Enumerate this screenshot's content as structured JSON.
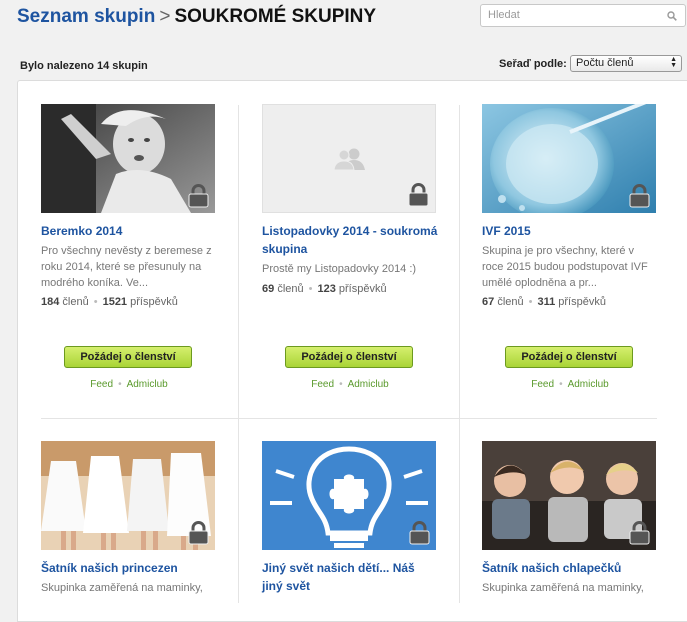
{
  "header": {
    "breadcrumb_link": "Seznam skupin",
    "separator": ">",
    "current": "SOUKROMÉ SKUPINY",
    "search_placeholder": "Hledat"
  },
  "toolbar": {
    "result_count": "Bylo nalezeno 14 skupin",
    "sort_label": "Seřaď podle:",
    "sort_value": "Počtu členů"
  },
  "groups": [
    {
      "name": "Beremko 2014",
      "description": "Pro všechny nevěsty z beremese z roku 2014, které se přesunuly na modrého koníka. Ve...",
      "members": "184",
      "members_label": "členů",
      "posts": "1521",
      "posts_label": "příspěvků",
      "join_label": "Požádej o členství",
      "link1": "Feed",
      "link2": "Admiclub",
      "private": true
    },
    {
      "name": "Listopadovky 2014 - soukromá skupina",
      "description": "Prostě my Listopadovky 2014 :)",
      "members": "69",
      "members_label": "členů",
      "posts": "123",
      "posts_label": "příspěvků",
      "join_label": "Požádej o členství",
      "link1": "Feed",
      "link2": "Admiclub",
      "private": true
    },
    {
      "name": "IVF 2015",
      "description": "Skupina je pro všechny, které v roce 2015 budou podstupovat IVF umělé oplodněna a pr...",
      "members": "67",
      "members_label": "členů",
      "posts": "311",
      "posts_label": "příspěvků",
      "join_label": "Požádej o členství",
      "link1": "Feed",
      "link2": "Admiclub",
      "private": true
    },
    {
      "name": "Šatník našich princezen",
      "description": "Skupinka zaměřená na maminky,",
      "private": true
    },
    {
      "name": "Jiný svět našich dětí... Náš jiný svět",
      "description": "",
      "private": true
    },
    {
      "name": "Šatník našich chlapečků",
      "description": "Skupinka zaměřená na maminky,",
      "private": true
    }
  ],
  "colors": {
    "link_blue": "#1e54a0",
    "join_green": "#a9d436",
    "footer_link_green": "#5a9a2c"
  },
  "icons": [
    "search-icon",
    "lock-icon",
    "group-placeholder-icon"
  ]
}
